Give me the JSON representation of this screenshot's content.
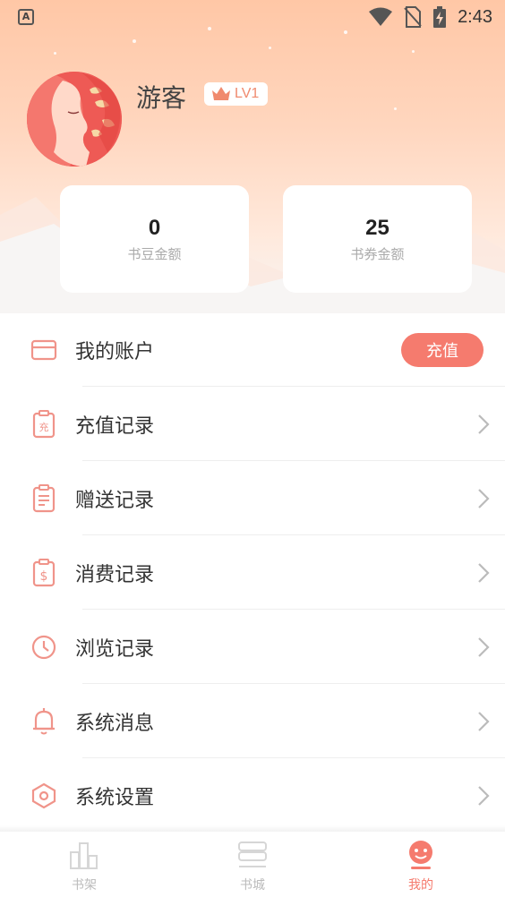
{
  "status_bar": {
    "app_icon_letter": "A",
    "time": "2:43"
  },
  "profile": {
    "username": "游客",
    "level": "LV1"
  },
  "stats": [
    {
      "value": "0",
      "label": "书豆金额"
    },
    {
      "value": "25",
      "label": "书券金额"
    }
  ],
  "menu": {
    "account": {
      "label": "我的账户",
      "button_label": "充值"
    },
    "recharge_record": {
      "label": "充值记录",
      "icon_text": "充"
    },
    "gift_record": {
      "label": "赠送记录"
    },
    "spending_record": {
      "label": "消费记录",
      "icon_text": "$"
    },
    "browse_record": {
      "label": "浏览记录"
    },
    "system_messages": {
      "label": "系统消息"
    },
    "system_settings": {
      "label": "系统设置"
    }
  },
  "tabbar": {
    "tabs": [
      {
        "label": "书架",
        "icon": "bookshelf-icon"
      },
      {
        "label": "书城",
        "icon": "bookstore-icon"
      },
      {
        "label": "我的",
        "icon": "profile-icon",
        "active": true
      }
    ]
  },
  "colors": {
    "accent": "#f57b6e",
    "icon": "#f0948a",
    "header_top": "#ffc7a6"
  }
}
